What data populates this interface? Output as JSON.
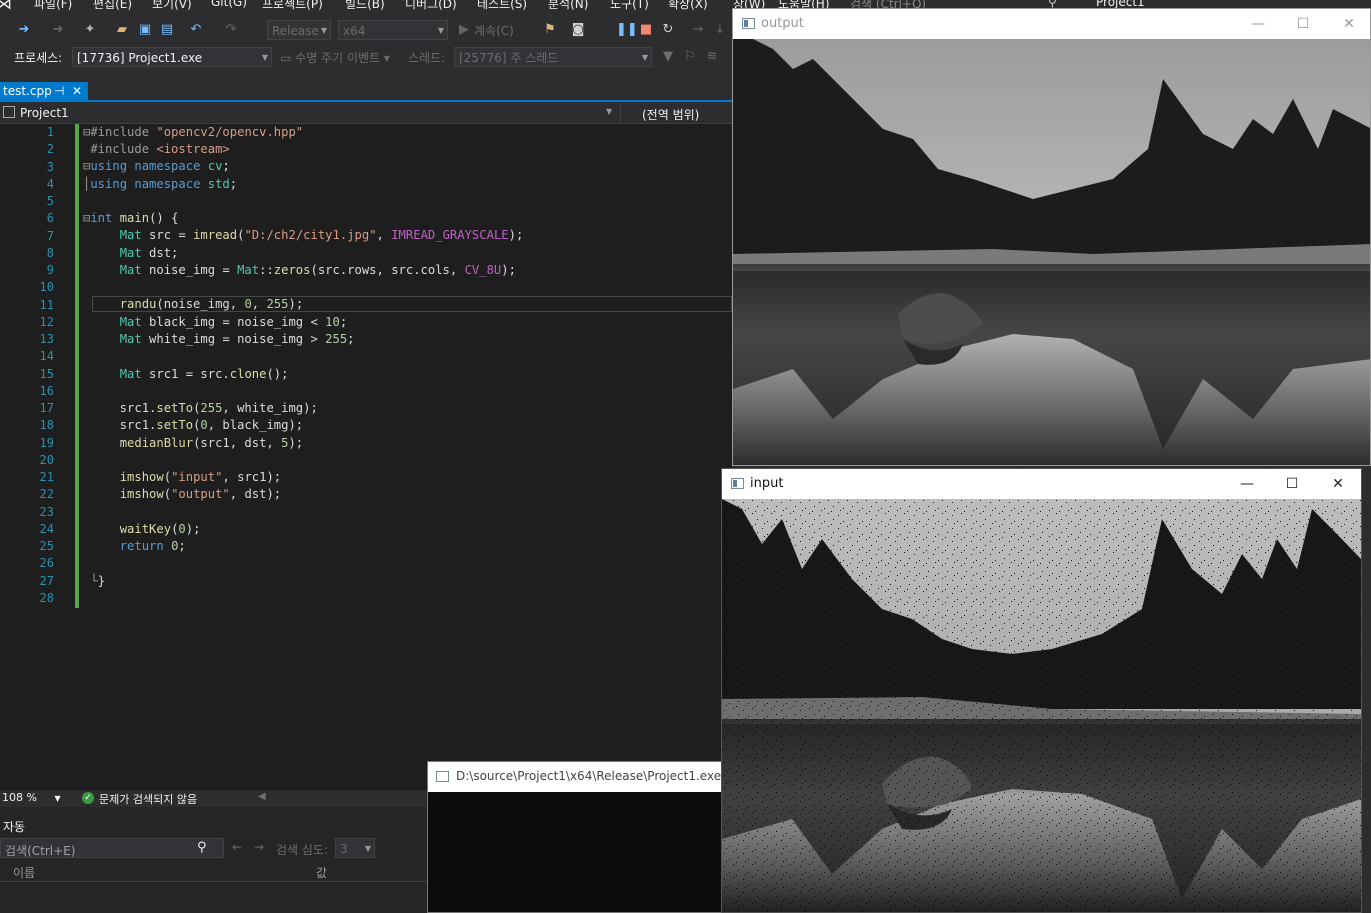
{
  "menu": [
    "파일(F)",
    "편집(E)",
    "보기(V)",
    "Git(G)",
    "프로젝트(P)",
    "빌드(B)",
    "디버그(D)",
    "테스트(S)",
    "분석(N)",
    "도구(T)",
    "확장(X)",
    "창(W)",
    "도움말(H)"
  ],
  "search_placeholder": "검색 (Ctrl+Q)",
  "top_project": "Project1",
  "toolbar": {
    "config": "Release",
    "platform": "x64",
    "continue": "계속(C)"
  },
  "debug_bar": {
    "process_label": "프로세스:",
    "process_value": "[17736] Project1.exe",
    "lifecycle": "수명 주기 이벤트",
    "thread_label": "스레드:",
    "thread_value": "[25776] 주 스레드"
  },
  "tab": {
    "name": "test.cpp",
    "pin": "⊣",
    "close": "✕"
  },
  "nav": {
    "project": "Project1",
    "scope": "(전역 범위)"
  },
  "editor": {
    "line_numbers": [
      "1",
      "2",
      "3",
      "4",
      "5",
      "6",
      "7",
      "8",
      "9",
      "10",
      "11",
      "12",
      "13",
      "14",
      "15",
      "16",
      "17",
      "18",
      "19",
      "20",
      "21",
      "22",
      "23",
      "24",
      "25",
      "26",
      "27",
      "28"
    ],
    "strings": {
      "inc1": "\"opencv2/opencv.hpp\"",
      "inc2": "<iostream>",
      "path": "\"D:/ch2/city1.jpg\"",
      "input": "\"input\"",
      "output": "\"output\""
    }
  },
  "status": {
    "zoom": "108 %",
    "problems": "문제가 검색되지 않음"
  },
  "autos": {
    "title": "자동",
    "search": "검색(Ctrl+E)",
    "depth_label": "검색 심도:",
    "depth_value": "3",
    "col_name": "이름",
    "col_value": "값"
  },
  "console": {
    "title": "D:\\source\\Project1\\x64\\Release\\Project1.exe"
  },
  "windows": {
    "output": {
      "title": "output"
    },
    "input": {
      "title": "input"
    }
  },
  "window_buttons": {
    "min": "—",
    "max": "☐",
    "close": "✕"
  }
}
